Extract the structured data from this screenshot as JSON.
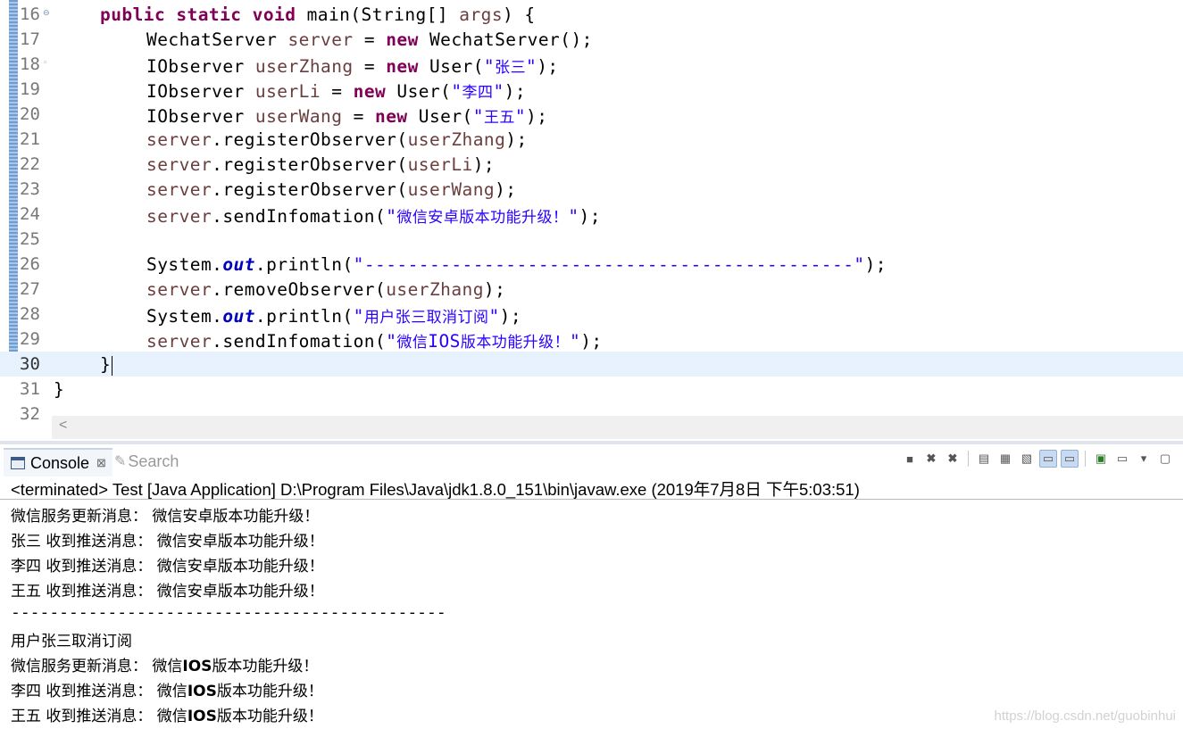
{
  "editor": {
    "lines": [
      {
        "n": "16",
        "fold": "⊖",
        "current": false
      },
      {
        "n": "17",
        "fold": "",
        "current": false
      },
      {
        "n": "18",
        "fold": "◦",
        "current": false
      },
      {
        "n": "19",
        "fold": "",
        "current": false
      },
      {
        "n": "20",
        "fold": "",
        "current": false
      },
      {
        "n": "21",
        "fold": "",
        "current": false
      },
      {
        "n": "22",
        "fold": "",
        "current": false
      },
      {
        "n": "23",
        "fold": "",
        "current": false
      },
      {
        "n": "24",
        "fold": "",
        "current": false
      },
      {
        "n": "25",
        "fold": "",
        "current": false
      },
      {
        "n": "26",
        "fold": "",
        "current": false
      },
      {
        "n": "27",
        "fold": "",
        "current": false
      },
      {
        "n": "28",
        "fold": "",
        "current": false
      },
      {
        "n": "29",
        "fold": "",
        "current": false
      },
      {
        "n": "30",
        "fold": "",
        "current": true
      },
      {
        "n": "31",
        "fold": "",
        "current": false
      },
      {
        "n": "32",
        "fold": "",
        "current": false
      }
    ],
    "code": {
      "l16": {
        "kw": "public static void",
        "rest": " main(String[] ",
        "param": "args",
        "end": ") {"
      },
      "l17": {
        "type": "WechatServer ",
        "var": "server",
        "eq": " = ",
        "kw": "new",
        "rest": " WechatServer();"
      },
      "l18": {
        "type": "IObserver ",
        "var": "userZhang",
        "eq": " = ",
        "kw": "new",
        "rest": " User(",
        "q1": "\"",
        "cn": "张三",
        "q2": "\"",
        "end": ");"
      },
      "l19": {
        "type": "IObserver ",
        "var": "userLi",
        "eq": " = ",
        "kw": "new",
        "rest": " User(",
        "q1": "\"",
        "cn": "李四",
        "q2": "\"",
        "end": ");"
      },
      "l20": {
        "type": "IObserver ",
        "var": "userWang",
        "eq": " = ",
        "kw": "new",
        "rest": " User(",
        "q1": "\"",
        "cn": "王五",
        "q2": "\"",
        "end": ");"
      },
      "l21": {
        "obj": "server",
        "call": ".registerObserver(",
        "arg": "userZhang",
        "end": ");"
      },
      "l22": {
        "obj": "server",
        "call": ".registerObserver(",
        "arg": "userLi",
        "end": ");"
      },
      "l23": {
        "obj": "server",
        "call": ".registerObserver(",
        "arg": "userWang",
        "end": ");"
      },
      "l24": {
        "obj": "server",
        "call": ".sendInfomation(",
        "q1": "\"",
        "cn": "微信安卓版本功能升级！",
        "q2": "\"",
        "end": ");"
      },
      "l26": {
        "sys": "System.",
        "fld": "out",
        "call": ".println(",
        "str": "\"---------------------------------------------\"",
        "end": ");"
      },
      "l27": {
        "obj": "server",
        "call": ".removeObserver(",
        "arg": "userZhang",
        "end": ");"
      },
      "l28": {
        "sys": "System.",
        "fld": "out",
        "call": ".println(",
        "q1": "\"",
        "cn": "用户张三取消订阅",
        "q2": "\"",
        "end": ");"
      },
      "l29": {
        "obj": "server",
        "call": ".sendInfomation(",
        "q1": "\"",
        "cn": "微信",
        "lat": "IOS",
        "cn2": "版本功能升级！",
        "q2": "\"",
        "end": ");"
      },
      "l30": {
        "text": "}"
      },
      "l31": {
        "text": "}"
      }
    }
  },
  "console": {
    "tabs": [
      {
        "label": "Console",
        "close": "⊠"
      },
      {
        "label": "Search"
      }
    ],
    "toolbar_icons": [
      "terminate-icon",
      "remove-launch-icon",
      "remove-all-icon",
      "scroll-lock-icon",
      "word-wrap-icon",
      "pin-console-icon",
      "show-stdout-icon",
      "show-stderr-icon",
      "display-console-icon",
      "open-console-icon",
      "view-menu-icon",
      "maximize-icon"
    ],
    "header": "<terminated> Test [Java Application] D:\\Program Files\\Java\\jdk1.8.0_151\\bin\\javaw.exe (2019年7月8日 下午5:03:51)",
    "output": [
      {
        "a": "微信服务更新消息： 微信安卓版本功能升级！"
      },
      {
        "a": "张三 收到推送消息： 微信安卓版本功能升级！"
      },
      {
        "a": "李四 收到推送消息： 微信安卓版本功能升级！"
      },
      {
        "a": "王五 收到推送消息： 微信安卓版本功能升级！"
      },
      {
        "mono": "---------------------------------------------"
      },
      {
        "a": "用户张三取消订阅"
      },
      {
        "a": "微信服务更新消息： 微信",
        "lat": "IOS",
        "b": "版本功能升级！"
      },
      {
        "a": "李四 收到推送消息： 微信",
        "lat": "IOS",
        "b": "版本功能升级！"
      },
      {
        "a": "王五 收到推送消息： 微信",
        "lat": "IOS",
        "b": "版本功能升级！"
      }
    ]
  },
  "watermark": "https://blog.csdn.net/guobinhui"
}
